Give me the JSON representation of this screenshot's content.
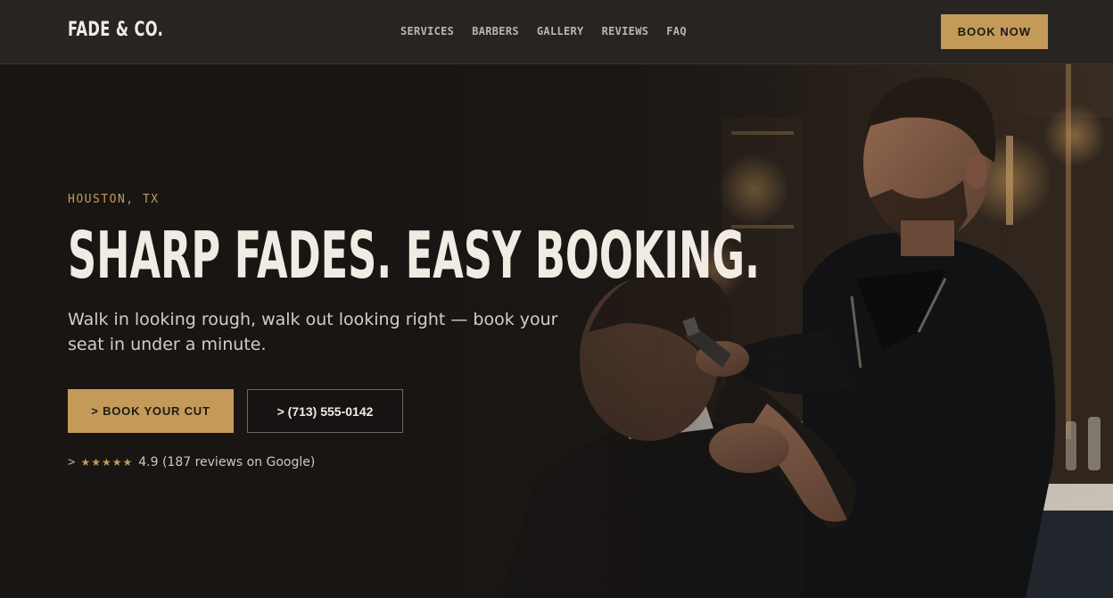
{
  "header": {
    "logo": "FADE & CO.",
    "nav": [
      "SERVICES",
      "BARBERS",
      "GALLERY",
      "REVIEWS",
      "FAQ"
    ],
    "cta_label": "BOOK NOW"
  },
  "hero": {
    "eyebrow": "HOUSTON, TX",
    "headline": "SHARP FADES. EASY BOOKING.",
    "subtitle": "Walk in looking rough, walk out looking right — book your seat in under a minute.",
    "primary_button": "> BOOK YOUR CUT",
    "secondary_button": "> (713) 555-0142",
    "rating": {
      "prefix": ">",
      "stars": "★★★★★",
      "text": "4.9 (187 reviews on Google)"
    }
  },
  "colors": {
    "accent": "#c49a58",
    "background": "#1c1917",
    "header_bg": "#272422",
    "text": "#ece6dc"
  },
  "icons": [
    "barber-photo-image",
    "star-icon"
  ]
}
